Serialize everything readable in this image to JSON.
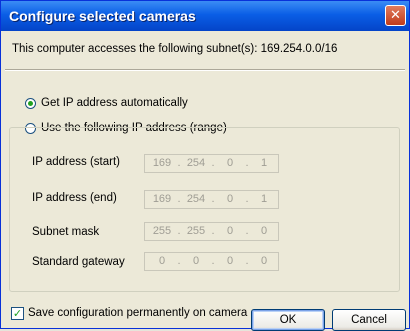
{
  "window": {
    "title": "Configure selected cameras",
    "close_glyph": "✕"
  },
  "info": {
    "subnet_text": "This computer accesses the following subnet(s): 169.254.0.0/16"
  },
  "mode": {
    "auto_label": "Get IP address automatically",
    "manual_label": "Use the following IP address (range)",
    "selected": "auto"
  },
  "fields": {
    "ip_start": {
      "label": "IP address (start)",
      "octets": [
        "169",
        "254",
        "0",
        "1"
      ]
    },
    "ip_end": {
      "label": "IP address (end)",
      "octets": [
        "169",
        "254",
        "0",
        "1"
      ]
    },
    "subnet_mask": {
      "label": "Subnet mask",
      "octets": [
        "255",
        "255",
        "0",
        "0"
      ]
    },
    "gateway": {
      "label": "Standard gateway",
      "octets": [
        "0",
        "0",
        "0",
        "0"
      ]
    },
    "dot": "."
  },
  "save_config": {
    "label": "Save configuration permanently on camera",
    "checked": true,
    "check_glyph": "✓"
  },
  "buttons": {
    "ok": "OK",
    "cancel": "Cancel"
  },
  "colors": {
    "titlebar": "#0a5ee6",
    "radio_dot": "#21a121",
    "disabled_text": "#9f9d94"
  }
}
